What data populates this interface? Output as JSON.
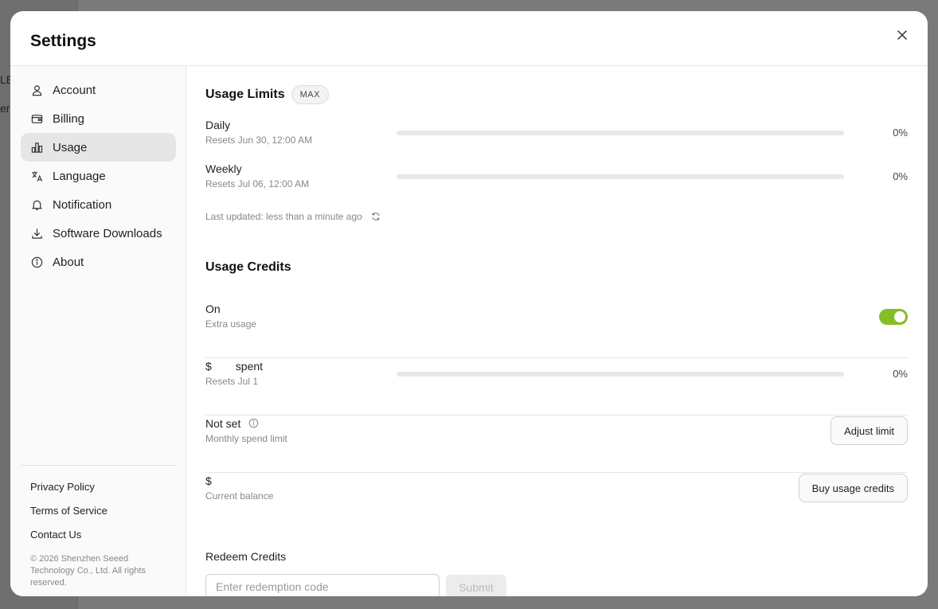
{
  "background": {
    "text1": "LE",
    "text2": "er"
  },
  "modal": {
    "title": "Settings"
  },
  "sidebar": {
    "items": [
      {
        "label": "Account",
        "icon": "user-icon"
      },
      {
        "label": "Billing",
        "icon": "wallet-icon"
      },
      {
        "label": "Usage",
        "icon": "bar-chart-icon",
        "active": true
      },
      {
        "label": "Language",
        "icon": "translate-icon"
      },
      {
        "label": "Notification",
        "icon": "bell-icon"
      },
      {
        "label": "Software Downloads",
        "icon": "download-icon"
      },
      {
        "label": "About",
        "icon": "info-icon"
      }
    ],
    "footer": {
      "privacy": "Privacy Policy",
      "terms": "Terms of Service",
      "contact": "Contact Us",
      "copyright": "© 2026 Shenzhen Seeed Technology Co., Ltd. All rights reserved."
    }
  },
  "usage_limits": {
    "title": "Usage Limits",
    "badge": "MAX",
    "daily": {
      "label": "Daily",
      "sub": "Resets Jun 30, 12:00 AM",
      "percent": "0%",
      "progress": 0
    },
    "weekly": {
      "label": "Weekly",
      "sub": "Resets Jul 06, 12:00 AM",
      "percent": "0%",
      "progress": 0
    },
    "last_updated": "Last updated: less than a minute ago"
  },
  "usage_credits": {
    "title": "Usage Credits",
    "toggle": {
      "label": "On",
      "sub": "Extra usage",
      "on": true
    },
    "spent": {
      "currency": "$",
      "label": "spent",
      "sub": "Resets Jul 1",
      "percent": "0%",
      "progress": 0
    },
    "limit": {
      "label": "Not set",
      "sub": "Monthly spend limit",
      "button": "Adjust limit"
    },
    "balance": {
      "label": "$",
      "sub": "Current balance",
      "button": "Buy usage credits"
    }
  },
  "redeem": {
    "title": "Redeem Credits",
    "placeholder": "Enter redemption code",
    "submit": "Submit"
  },
  "colors": {
    "accent": "#84bd25",
    "overlay": "#7a7a7a"
  }
}
